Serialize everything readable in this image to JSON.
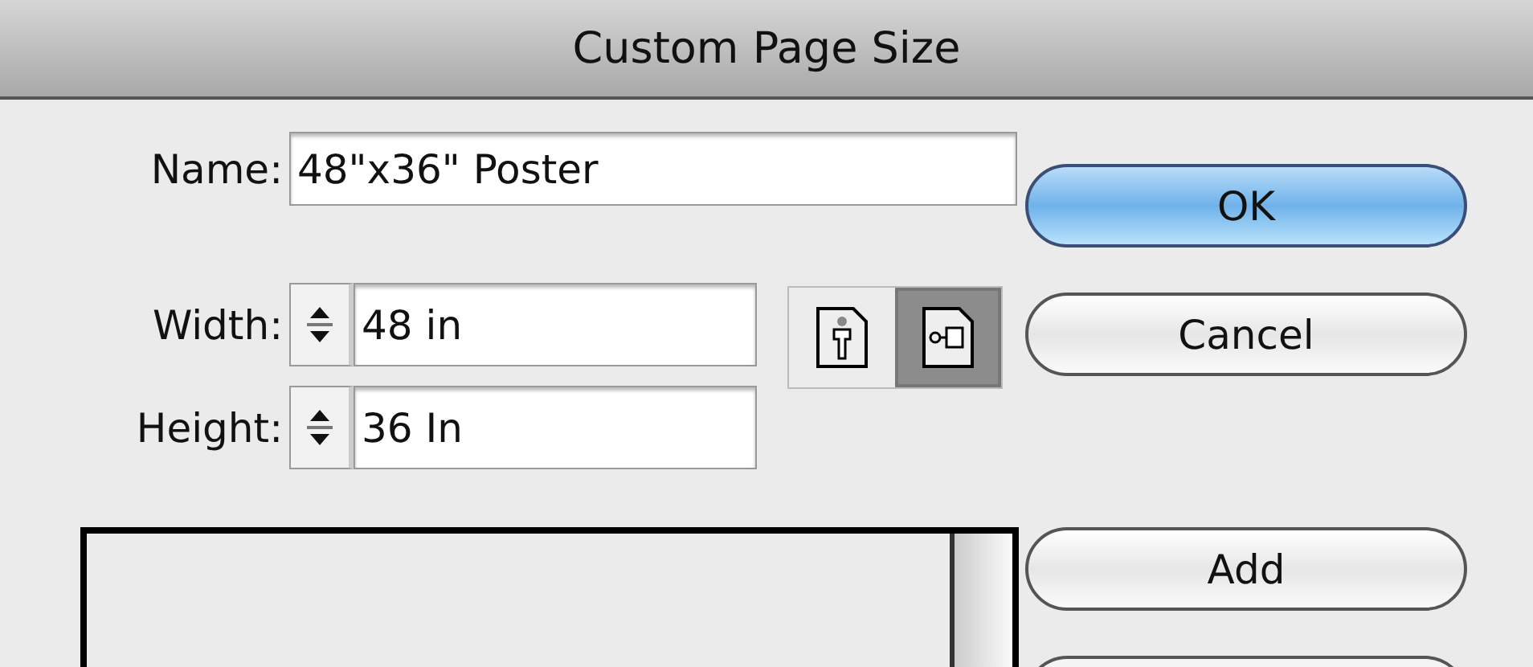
{
  "window": {
    "title": "Custom Page Size"
  },
  "fields": [
    {
      "label": "Name:",
      "value": "48\"x36\" Poster",
      "kind": "text"
    },
    {
      "label": "Width:",
      "value": "48 in",
      "kind": "spinner"
    },
    {
      "label": "Height:",
      "value": "36 In",
      "kind": "spinner"
    }
  ],
  "orientation": [
    {
      "kind": "portrait",
      "selected": false
    },
    {
      "kind": "landscape",
      "selected": true
    }
  ],
  "buttons": [
    {
      "label": "OK",
      "default": true
    },
    {
      "label": "Cancel",
      "default": false
    },
    {
      "label": "Add",
      "default": false
    }
  ]
}
